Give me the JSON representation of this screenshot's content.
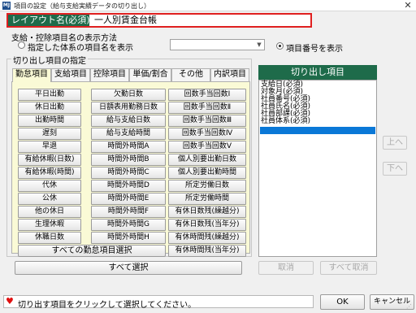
{
  "window": {
    "title": "項目の設定（給与支給実績データの切り出し）",
    "icon_label": "MJ"
  },
  "layout": {
    "label": "レイアウト名(必須)",
    "value": "一人別賃金台帳"
  },
  "display": {
    "heading": "支給・控除項目名の表示方法",
    "option_system": "指定した体系の項目名を表示",
    "option_number": "項目番号を表示",
    "selected": "option_number",
    "combo_value": ""
  },
  "selection": {
    "heading": "切り出し項目の指定",
    "tabs": [
      "勤怠項目",
      "支給項目",
      "控除項目",
      "単価/割合",
      "その他",
      "内訳項目"
    ],
    "active_tab": 0,
    "col1": [
      "平日出勤",
      "休日出勤",
      "出勤時間",
      "遅刻",
      "早退",
      "有給休暇(日数)",
      "有給休暇(時間)",
      "代休",
      "公休",
      "他の休日",
      "生理休暇",
      "休職日数"
    ],
    "col2": [
      "欠勤日数",
      "日額表用勤務日数",
      "給与支給日数",
      "給与支給時間",
      "時間外時間A",
      "時間外時間B",
      "時間外時間C",
      "時間外時間D",
      "時間外時間E",
      "時間外時間F",
      "時間外時間G",
      "時間外時間H"
    ],
    "col3": [
      "回数手当回数Ⅰ",
      "回数手当回数Ⅱ",
      "回数手当回数Ⅲ",
      "回数手当回数Ⅳ",
      "回数手当回数Ⅴ",
      "個人別要出勤日数",
      "個人別要出勤時間",
      "所定労働日数",
      "所定労働時間",
      "有休日数残(繰越分)",
      "有休日数残(当年分)",
      "有休時間残(繰越分)",
      "有休時間残(当年分)"
    ],
    "all_attendance_button": "すべての勤怠項目選択",
    "select_all_button": "すべて選択"
  },
  "extract": {
    "header": "切り出し項目",
    "items": [
      "支給日(必須)",
      "対象月(必須)",
      "社員番号(必須)",
      "社員氏名(必須)",
      "社員部課(必須)",
      "社員体系(必須)",
      ""
    ],
    "selected_index": 6,
    "up_button": "上へ",
    "down_button": "下へ",
    "cancel_button": "取消",
    "cancel_all_button": "すべて取消"
  },
  "footer": {
    "status": "切り出す項目をクリックして選択してください。",
    "ok": "OK",
    "cancel": "キャンセル"
  },
  "colors": {
    "accent_green": "#1e6b4a",
    "panel_yellow": "#fafad6",
    "highlight_red": "#e02020",
    "selection_blue": "#0a78d7"
  }
}
